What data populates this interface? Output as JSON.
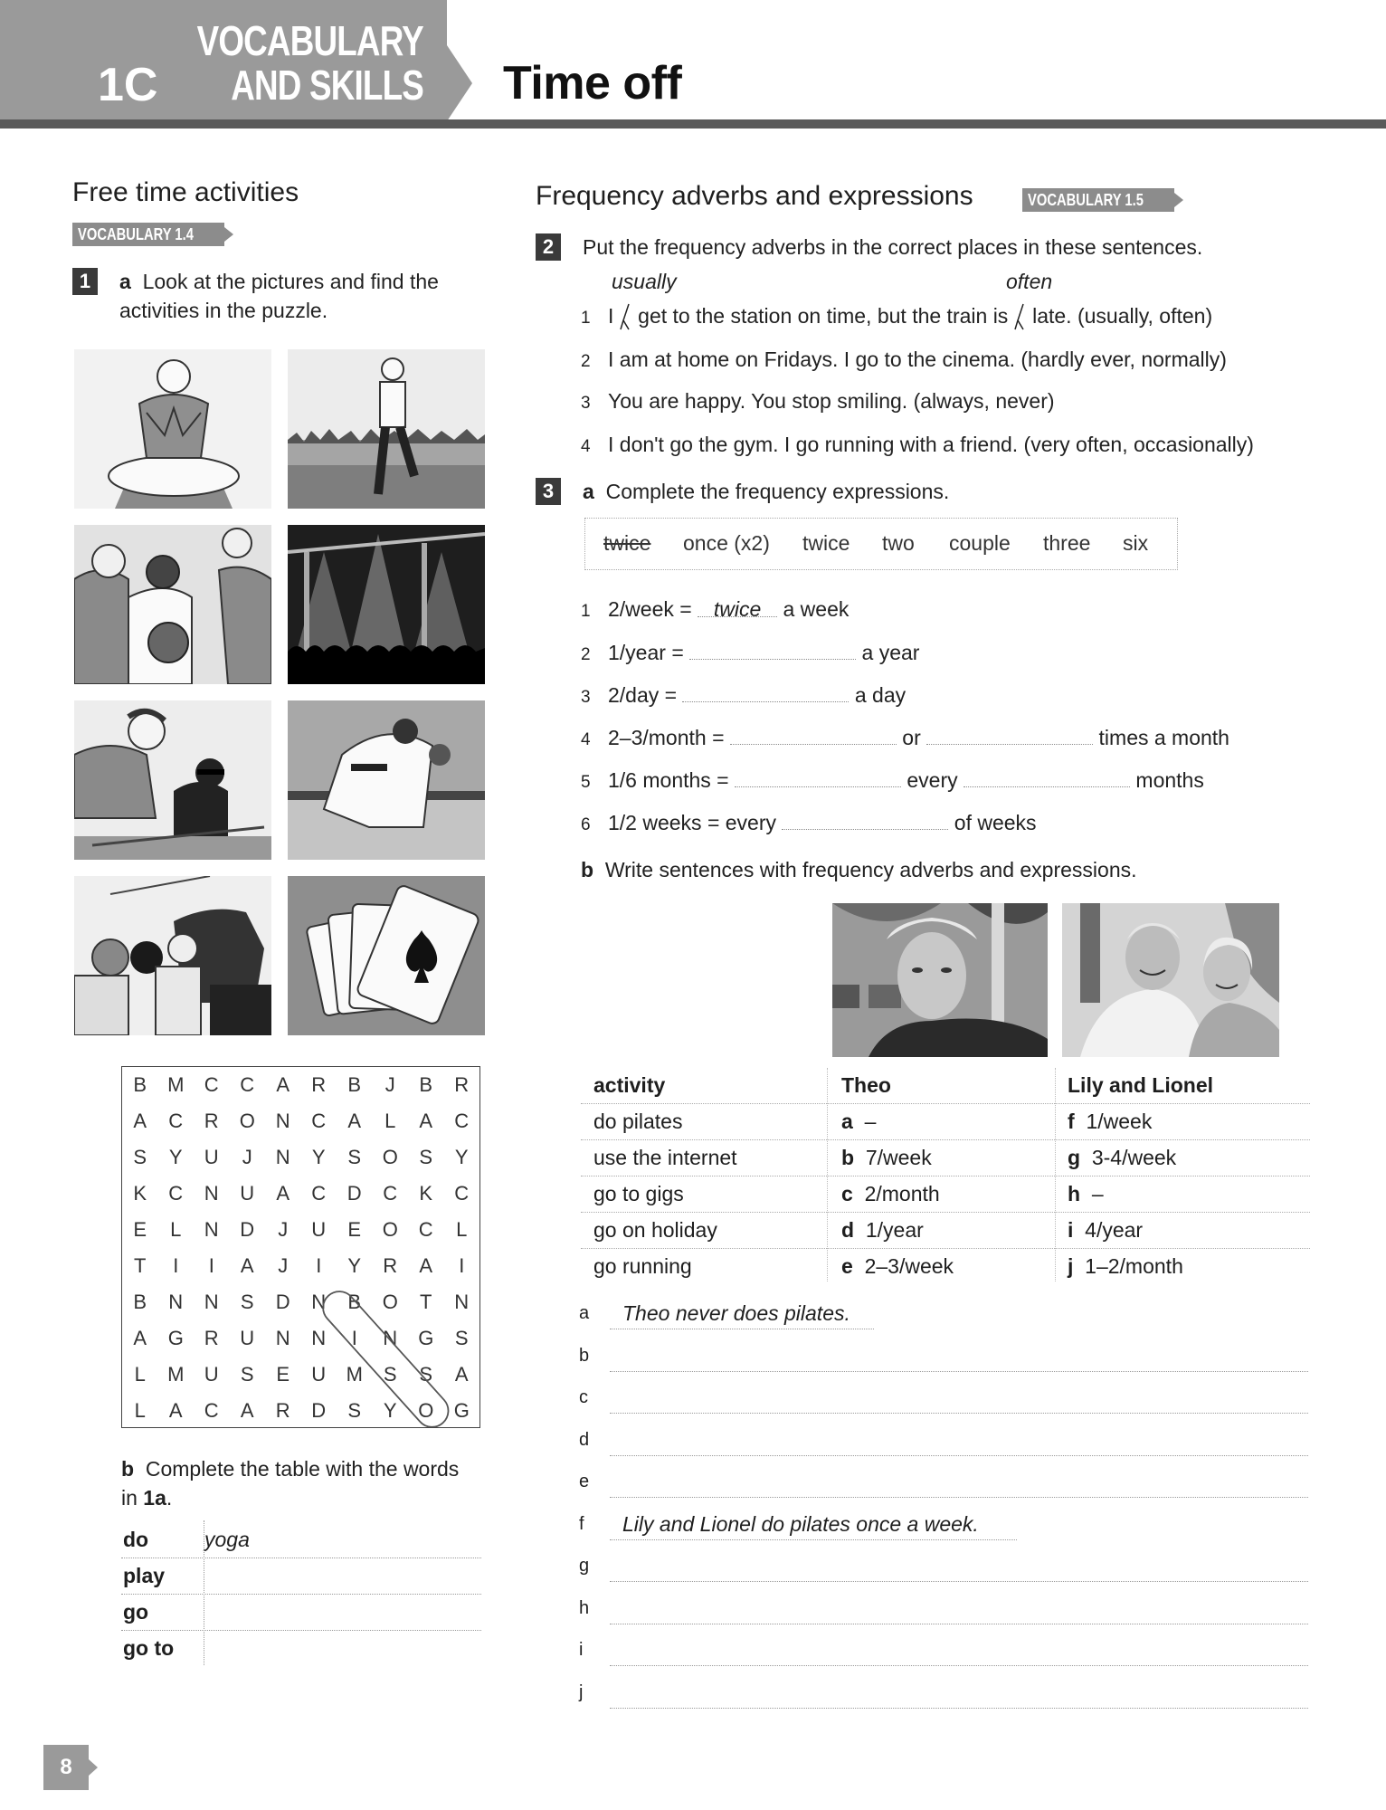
{
  "header": {
    "unit": "1C",
    "section_line1": "VOCABULARY",
    "section_line2": "AND SKILLS",
    "title": "Time off"
  },
  "left": {
    "section_title": "Free time activities",
    "vocab_tag": "VOCABULARY 1.4",
    "ex1": {
      "number": "1",
      "part_a_letter": "a",
      "part_a_line1": "Look at the pictures and find the",
      "part_a_line2": "activities in the puzzle.",
      "pictures": [
        {
          "subject": "yoga"
        },
        {
          "subject": "running"
        },
        {
          "subject": "basketball"
        },
        {
          "subject": "gig / concert"
        },
        {
          "subject": "cycling"
        },
        {
          "subject": "judo"
        },
        {
          "subject": "museum"
        },
        {
          "subject": "cards"
        }
      ],
      "wordsearch": {
        "rows": [
          [
            "B",
            "M",
            "C",
            "C",
            "A",
            "R",
            "B",
            "J",
            "B",
            "R"
          ],
          [
            "A",
            "C",
            "R",
            "O",
            "N",
            "C",
            "A",
            "L",
            "A",
            "C"
          ],
          [
            "S",
            "Y",
            "U",
            "J",
            "N",
            "Y",
            "S",
            "O",
            "S",
            "Y"
          ],
          [
            "K",
            "C",
            "N",
            "U",
            "A",
            "C",
            "D",
            "C",
            "K",
            "C"
          ],
          [
            "E",
            "L",
            "N",
            "D",
            "J",
            "U",
            "E",
            "O",
            "C",
            "L"
          ],
          [
            "T",
            "I",
            "I",
            "A",
            "J",
            "I",
            "Y",
            "R",
            "A",
            "I"
          ],
          [
            "B",
            "N",
            "N",
            "S",
            "D",
            "N",
            "B",
            "O",
            "T",
            "N"
          ],
          [
            "A",
            "G",
            "R",
            "U",
            "N",
            "N",
            "I",
            "N",
            "G",
            "S"
          ],
          [
            "L",
            "M",
            "U",
            "S",
            "E",
            "U",
            "M",
            "S",
            "S",
            "A"
          ],
          [
            "L",
            "A",
            "C",
            "A",
            "R",
            "D",
            "S",
            "Y",
            "O",
            "G"
          ]
        ],
        "highlighted_word": "YOGA"
      },
      "part_b_letter": "b",
      "part_b_line1": "Complete the table with the words",
      "part_b_line2_prefix": "in",
      "part_b_line2_ref": "1a",
      "part_b_line2_suffix": ".",
      "table": [
        {
          "verb": "do",
          "value": "yoga"
        },
        {
          "verb": "play",
          "value": ""
        },
        {
          "verb": "go",
          "value": ""
        },
        {
          "verb": "go to",
          "value": ""
        }
      ]
    }
  },
  "right": {
    "section_title": "Frequency adverbs and expressions",
    "vocab_tag": "VOCABULARY 1.5",
    "ex2": {
      "number": "2",
      "instruction": "Put the frequency adverbs in the correct places in these sentences.",
      "handwritten_1": "usually",
      "handwritten_2": "often",
      "items": [
        {
          "n": "1",
          "part1": "I",
          "part2": "get to the station on time, but the train is",
          "part3": "late. (usually, often)"
        },
        {
          "n": "2",
          "text": "I am at home on Fridays. I go to the cinema. (hardly ever, normally)"
        },
        {
          "n": "3",
          "text": "You are happy. You stop smiling. (always, never)"
        },
        {
          "n": "4",
          "text": "I don't go the gym. I go running with a friend. (very often, occasionally)"
        }
      ]
    },
    "ex3": {
      "number": "3",
      "part_a_letter": "a",
      "part_a_instruction": "Complete the frequency expressions.",
      "word_box": [
        {
          "word": "twice",
          "crossed": true
        },
        {
          "word": "once (x2)",
          "crossed": false
        },
        {
          "word": "twice",
          "crossed": false
        },
        {
          "word": "two",
          "crossed": false
        },
        {
          "word": "couple",
          "crossed": false
        },
        {
          "word": "three",
          "crossed": false
        },
        {
          "word": "six",
          "crossed": false
        }
      ],
      "items": [
        {
          "n": "1",
          "lead": "2/week =",
          "answer": "twice",
          "after": "a week"
        },
        {
          "n": "2",
          "lead": "1/year =",
          "after": "a year"
        },
        {
          "n": "3",
          "lead": "2/day =",
          "after": "a day"
        },
        {
          "n": "4",
          "lead": "2–3/month =",
          "mid": "or",
          "after": "times a month"
        },
        {
          "n": "5",
          "lead": "1/6 months =",
          "mid": "every",
          "after": "months"
        },
        {
          "n": "6",
          "lead": "1/2 weeks = every",
          "after": "of weeks"
        }
      ],
      "part_b_letter": "b",
      "part_b_instruction": "Write sentences with frequency adverbs and expressions.",
      "photos": [
        {
          "subject": "Theo"
        },
        {
          "subject": "Lily and Lionel"
        }
      ],
      "table": {
        "headers": [
          "activity",
          "Theo",
          "Lily and Lionel"
        ],
        "rows": [
          {
            "activity": "do pilates",
            "theo_letter": "a",
            "theo": "–",
            "ll_letter": "f",
            "ll": "1/week"
          },
          {
            "activity": "use the internet",
            "theo_letter": "b",
            "theo": "7/week",
            "ll_letter": "g",
            "ll": "3-4/week"
          },
          {
            "activity": "go to gigs",
            "theo_letter": "c",
            "theo": "2/month",
            "ll_letter": "h",
            "ll": "–"
          },
          {
            "activity": "go on holiday",
            "theo_letter": "d",
            "theo": "1/year",
            "ll_letter": "i",
            "ll": "4/year"
          },
          {
            "activity": "go running",
            "theo_letter": "e",
            "theo": "2–3/week",
            "ll_letter": "j",
            "ll": "1–2/month"
          }
        ]
      },
      "answer_lines": [
        {
          "letter": "a",
          "answer": "Theo never does pilates."
        },
        {
          "letter": "b",
          "answer": ""
        },
        {
          "letter": "c",
          "answer": ""
        },
        {
          "letter": "d",
          "answer": ""
        },
        {
          "letter": "e",
          "answer": ""
        },
        {
          "letter": "f",
          "answer": "Lily and Lionel do pilates once a week."
        },
        {
          "letter": "g",
          "answer": ""
        },
        {
          "letter": "h",
          "answer": ""
        },
        {
          "letter": "i",
          "answer": ""
        },
        {
          "letter": "j",
          "answer": ""
        }
      ]
    }
  },
  "footer": {
    "page_number": "8"
  }
}
